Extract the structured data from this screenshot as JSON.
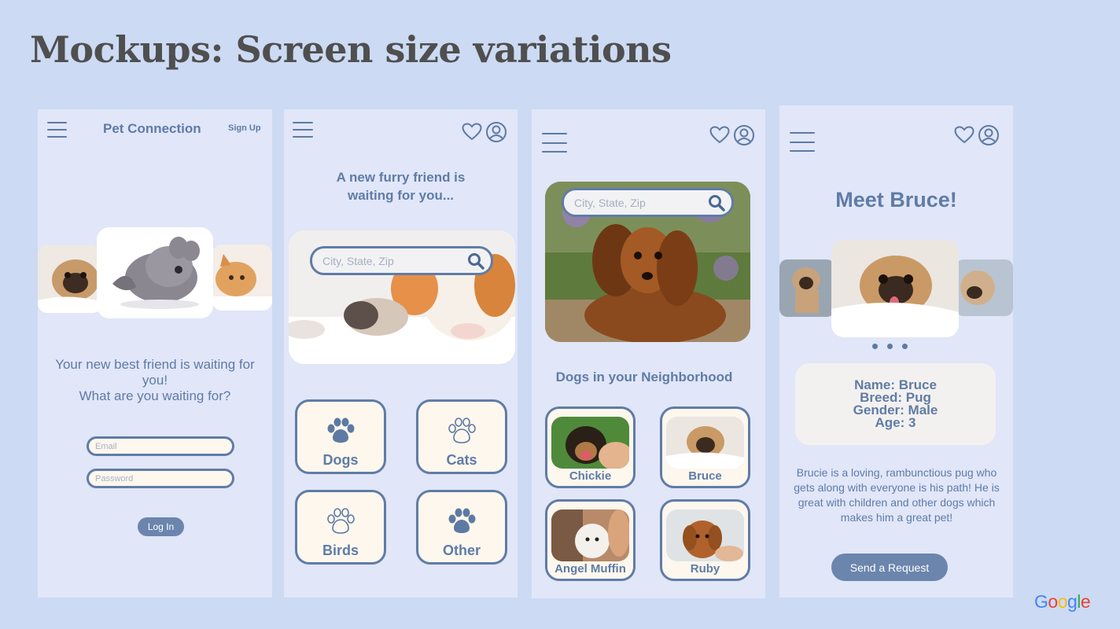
{
  "slide": {
    "title": "Mockups: Screen size variations"
  },
  "brand": {
    "letters": [
      {
        "ch": "G",
        "color": "#4285F4"
      },
      {
        "ch": "o",
        "color": "#EA4335"
      },
      {
        "ch": "o",
        "color": "#FBBC05"
      },
      {
        "ch": "g",
        "color": "#4285F4"
      },
      {
        "ch": "l",
        "color": "#34A853"
      },
      {
        "ch": "e",
        "color": "#EA4335"
      }
    ]
  },
  "colors": {
    "background": "#ccdaf3",
    "phone": "#e1e6f8",
    "accent": "#607ca6",
    "cream": "#fdf7ee",
    "title": "#4f4f4f"
  },
  "screen1": {
    "menu_icon": "hamburger-icon",
    "app_name": "Pet Connection",
    "sign_up": "Sign Up",
    "carousel": [
      "pug",
      "chinchilla",
      "kitten"
    ],
    "tagline_lines": [
      "Your new best friend is waiting for",
      "you!",
      "What are you waiting for?"
    ],
    "email_placeholder": "Email",
    "password_placeholder": "Password",
    "login_label": "Log In"
  },
  "screen2": {
    "headline_lines": [
      "A new furry friend is",
      "waiting for you..."
    ],
    "search_placeholder": "City, State, Zip",
    "categories": [
      {
        "label": "Dogs",
        "icon": "paw-filled-icon"
      },
      {
        "label": "Cats",
        "icon": "paw-outline-icon"
      },
      {
        "label": "Birds",
        "icon": "paw-outline-icon"
      },
      {
        "label": "Other",
        "icon": "paw-filled-icon"
      }
    ]
  },
  "screen3": {
    "search_placeholder": "City, State, Zip",
    "section_title": "Dogs in your Neighborhood",
    "dogs": [
      {
        "name": "Chickie"
      },
      {
        "name": "Bruce"
      },
      {
        "name": "Angel Muffin"
      },
      {
        "name": "Ruby"
      }
    ]
  },
  "screen4": {
    "title": "Meet Bruce!",
    "info": [
      "Name: Bruce",
      "Breed: Pug",
      "Gender: Male",
      "Age: 3"
    ],
    "bio": "Brucie is a loving, rambunctious pug who gets along with everyone is his path! He is great with children and other dogs which makes him a great pet!",
    "request_label": "Send a Request"
  }
}
